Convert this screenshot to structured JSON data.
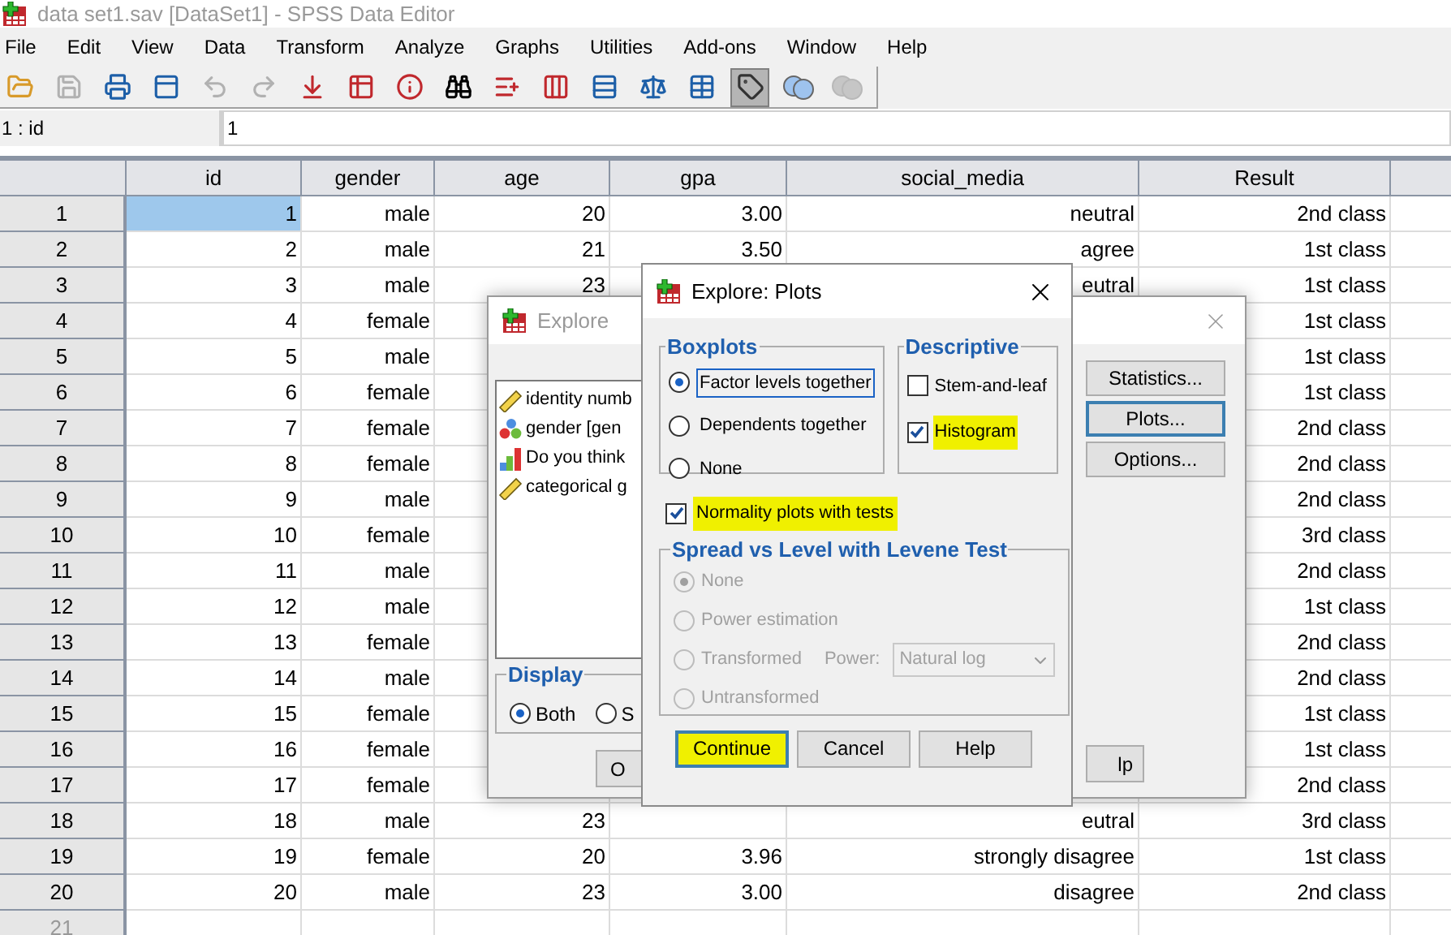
{
  "title_bar": {
    "title": "data set1.sav [DataSet1] - SPSS Data Editor",
    "active": false
  },
  "menu": [
    "File",
    "Edit",
    "View",
    "Data",
    "Transform",
    "Analyze",
    "Graphs",
    "Utilities",
    "Add-ons",
    "Window",
    "Help"
  ],
  "toolbar": [
    {
      "kind": "open",
      "disabled": false,
      "pressed": false
    },
    {
      "kind": "save",
      "disabled": true,
      "pressed": false
    },
    {
      "kind": "print",
      "disabled": false,
      "pressed": false
    },
    {
      "kind": "recall",
      "disabled": false,
      "pressed": false
    },
    {
      "kind": "undo",
      "disabled": true,
      "pressed": false
    },
    {
      "kind": "redo",
      "disabled": true,
      "pressed": false
    },
    {
      "kind": "goto_case",
      "disabled": false,
      "pressed": false
    },
    {
      "kind": "goto_variable",
      "disabled": false,
      "pressed": false
    },
    {
      "kind": "variables",
      "disabled": false,
      "pressed": false
    },
    {
      "kind": "find",
      "disabled": false,
      "pressed": false
    },
    {
      "kind": "insert_cases",
      "disabled": false,
      "pressed": false
    },
    {
      "kind": "insert_variable",
      "disabled": false,
      "pressed": false
    },
    {
      "kind": "split",
      "disabled": false,
      "pressed": false
    },
    {
      "kind": "weight",
      "disabled": false,
      "pressed": false
    },
    {
      "kind": "select",
      "disabled": false,
      "pressed": false
    },
    {
      "kind": "labels",
      "disabled": false,
      "pressed": true
    },
    {
      "kind": "use_sets",
      "disabled": false,
      "pressed": false
    },
    {
      "kind": "show_all",
      "disabled": true,
      "pressed": false
    }
  ],
  "cell_bar": {
    "reference": "1 : id",
    "value": "1"
  },
  "table": {
    "columns": [
      "id",
      "gender",
      "age",
      "gpa",
      "social_media",
      "Result"
    ],
    "rows": [
      {
        "number": "1",
        "selected": true,
        "empty": false,
        "cells": [
          "1",
          "male",
          "20",
          "3.00",
          "neutral",
          "2nd class"
        ]
      },
      {
        "number": "2",
        "selected": false,
        "empty": false,
        "cells": [
          "2",
          "male",
          "21",
          "3.50",
          "agree",
          "1st class"
        ]
      },
      {
        "number": "3",
        "selected": false,
        "empty": false,
        "cells": [
          "3",
          "male",
          "23",
          null,
          "eutral",
          "1st class"
        ]
      },
      {
        "number": "4",
        "selected": false,
        "empty": false,
        "cells": [
          "4",
          "female",
          null,
          null,
          null,
          "1st class"
        ]
      },
      {
        "number": "5",
        "selected": false,
        "empty": false,
        "cells": [
          "5",
          "male",
          null,
          null,
          null,
          "1st class"
        ]
      },
      {
        "number": "6",
        "selected": false,
        "empty": false,
        "cells": [
          "6",
          "female",
          null,
          null,
          null,
          "1st class"
        ]
      },
      {
        "number": "7",
        "selected": false,
        "empty": false,
        "cells": [
          "7",
          "female",
          null,
          null,
          null,
          "2nd class"
        ]
      },
      {
        "number": "8",
        "selected": false,
        "empty": false,
        "cells": [
          "8",
          "female",
          null,
          null,
          null,
          "2nd class"
        ]
      },
      {
        "number": "9",
        "selected": false,
        "empty": false,
        "cells": [
          "9",
          "male",
          null,
          null,
          null,
          "2nd class"
        ]
      },
      {
        "number": "10",
        "selected": false,
        "empty": false,
        "cells": [
          "10",
          "female",
          null,
          null,
          null,
          "3rd class"
        ]
      },
      {
        "number": "11",
        "selected": false,
        "empty": false,
        "cells": [
          "11",
          "male",
          null,
          null,
          null,
          "2nd class"
        ]
      },
      {
        "number": "12",
        "selected": false,
        "empty": false,
        "cells": [
          "12",
          "male",
          null,
          null,
          null,
          "1st class"
        ]
      },
      {
        "number": "13",
        "selected": false,
        "empty": false,
        "cells": [
          "13",
          "female",
          null,
          null,
          null,
          "2nd class"
        ]
      },
      {
        "number": "14",
        "selected": false,
        "empty": false,
        "cells": [
          "14",
          "male",
          null,
          null,
          null,
          "2nd class"
        ]
      },
      {
        "number": "15",
        "selected": false,
        "empty": false,
        "cells": [
          "15",
          "female",
          null,
          null,
          null,
          "1st class"
        ]
      },
      {
        "number": "16",
        "selected": false,
        "empty": false,
        "cells": [
          "16",
          "female",
          null,
          null,
          null,
          "1st class"
        ]
      },
      {
        "number": "17",
        "selected": false,
        "empty": false,
        "cells": [
          "17",
          "female",
          null,
          null,
          null,
          "2nd class"
        ]
      },
      {
        "number": "18",
        "selected": false,
        "empty": false,
        "cells": [
          "18",
          "male",
          "23",
          null,
          "eutral",
          "3rd class"
        ]
      },
      {
        "number": "19",
        "selected": false,
        "empty": false,
        "cells": [
          "19",
          "female",
          "20",
          "3.96",
          "strongly disagree",
          "1st class"
        ]
      },
      {
        "number": "20",
        "selected": false,
        "empty": false,
        "cells": [
          "20",
          "male",
          "23",
          "3.00",
          "disagree",
          "2nd class"
        ]
      },
      {
        "number": "21",
        "selected": false,
        "empty": true,
        "cells": [
          null,
          null,
          null,
          null,
          null,
          null
        ]
      }
    ]
  },
  "explore_dialog": {
    "title": "Explore",
    "active": false,
    "variables": [
      {
        "kind": "scale",
        "label": "identity numb"
      },
      {
        "kind": "nominal",
        "label": "gender  [gen"
      },
      {
        "kind": "ordinal",
        "label": "Do you think"
      },
      {
        "kind": "scale",
        "label": "categorical g"
      }
    ],
    "display": {
      "label": "Display",
      "options": [
        {
          "label": "Both",
          "selected": true
        },
        {
          "label": "S",
          "selected": false
        }
      ]
    },
    "side_buttons": [
      {
        "label": "Statistics...",
        "focused": false
      },
      {
        "label": "Plots...",
        "focused": true
      },
      {
        "label": "Options...",
        "focused": false
      }
    ],
    "ok_button": "O",
    "help_button": "lp"
  },
  "plots_dialog": {
    "title": "Explore: Plots",
    "boxplots": {
      "label": "Boxplots",
      "options": [
        {
          "label": "Factor levels together",
          "selected": true,
          "focused": true
        },
        {
          "label": "Dependents together",
          "selected": false,
          "focused": false
        },
        {
          "label": "None",
          "selected": false,
          "focused": false
        }
      ]
    },
    "descriptive": {
      "label": "Descriptive",
      "options": [
        {
          "label": "Stem-and-leaf",
          "checked": false,
          "highlighted": false
        },
        {
          "label": "Histogram",
          "checked": true,
          "highlighted": true
        }
      ]
    },
    "normality": {
      "label": "Normality plots with tests",
      "checked": true,
      "highlighted": true
    },
    "spread": {
      "label": "Spread vs Level with Levene Test",
      "disabled": true,
      "options": [
        {
          "label": "None",
          "selected": true
        },
        {
          "label": "Power estimation",
          "selected": false
        },
        {
          "label": "Transformed",
          "selected": false
        },
        {
          "label": "Untransformed",
          "selected": false
        }
      ],
      "power_label": "Power:",
      "power_value": "Natural log"
    },
    "buttons": [
      {
        "label": "Continue",
        "highlighted": true
      },
      {
        "label": "Cancel",
        "highlighted": false
      },
      {
        "label": "Help",
        "highlighted": false
      }
    ]
  }
}
